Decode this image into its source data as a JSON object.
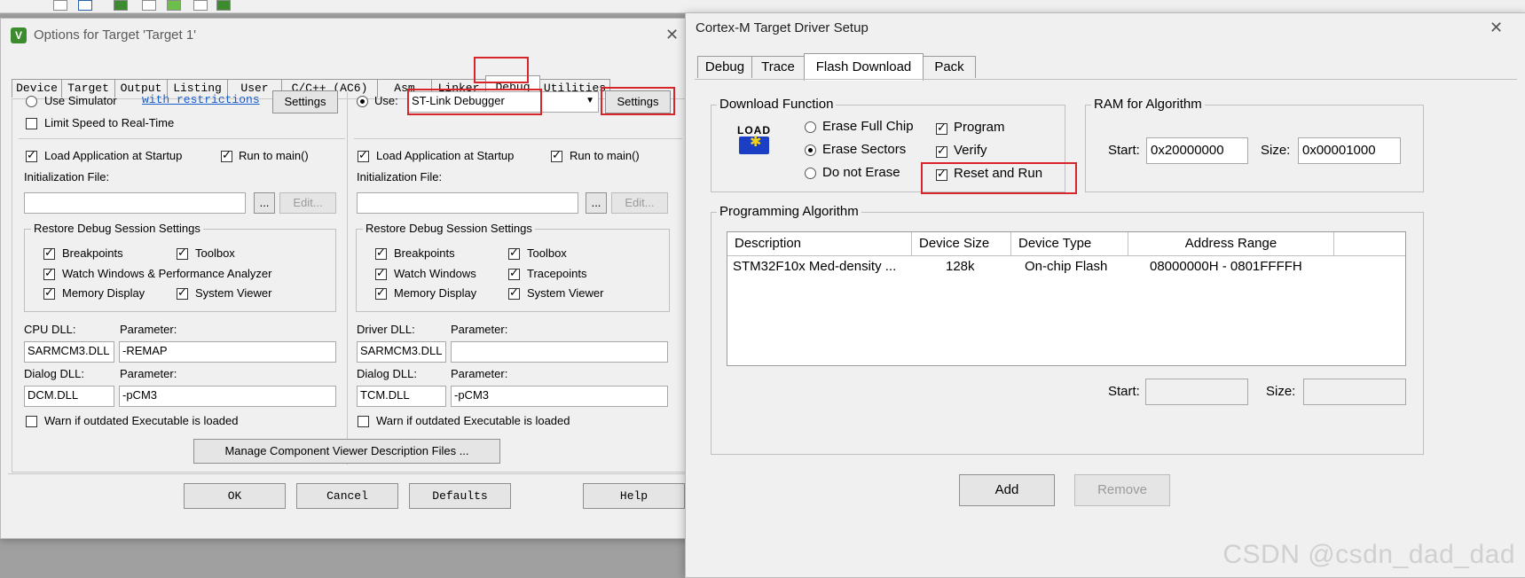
{
  "options_window": {
    "title": "Options for Target 'Target 1'",
    "tabs": [
      "Device",
      "Target",
      "Output",
      "Listing",
      "User",
      "C/C++ (AC6)",
      "Asm",
      "Linker",
      "Debug",
      "Utilities"
    ],
    "selected_tab": "Debug",
    "left": {
      "use_simulator": "Use Simulator",
      "with_restrictions": "with restrictions",
      "settings": "Settings",
      "limit_speed": "Limit Speed to Real-Time",
      "load_app": "Load Application at Startup",
      "run_to_main": "Run to main()",
      "init_file": "Initialization File:",
      "browse": "...",
      "edit": "Edit...",
      "restore_group": "Restore Debug Session Settings",
      "breakpoints": "Breakpoints",
      "toolbox": "Toolbox",
      "watch_windows": "Watch Windows & Performance Analyzer",
      "memory_display": "Memory Display",
      "system_viewer": "System Viewer",
      "cpu_dll_label": "CPU DLL:",
      "parameter_label": "Parameter:",
      "cpu_dll": "SARMCM3.DLL",
      "cpu_param": "-REMAP",
      "dialog_dll_label": "Dialog DLL:",
      "dialog_dll": "DCM.DLL",
      "dialog_param": "-pCM3",
      "warn": "Warn if outdated Executable is loaded"
    },
    "right": {
      "use": "Use:",
      "debugger": "ST-Link Debugger",
      "settings": "Settings",
      "load_app": "Load Application at Startup",
      "run_to_main": "Run to main()",
      "init_file": "Initialization File:",
      "browse": "...",
      "edit": "Edit...",
      "restore_group": "Restore Debug Session Settings",
      "breakpoints": "Breakpoints",
      "toolbox": "Toolbox",
      "watch_windows": "Watch Windows",
      "tracepoints": "Tracepoints",
      "memory_display": "Memory Display",
      "system_viewer": "System Viewer",
      "driver_dll_label": "Driver DLL:",
      "parameter_label": "Parameter:",
      "driver_dll": "SARMCM3.DLL",
      "driver_param": "",
      "dialog_dll_label": "Dialog DLL:",
      "dialog_dll": "TCM.DLL",
      "dialog_param": "-pCM3",
      "warn": "Warn if outdated Executable is loaded"
    },
    "manage_button": "Manage Component Viewer Description Files ...",
    "buttons": {
      "ok": "OK",
      "cancel": "Cancel",
      "defaults": "Defaults",
      "help": "Help"
    }
  },
  "driver_window": {
    "title": "Cortex-M Target Driver Setup",
    "tabs": [
      "Debug",
      "Trace",
      "Flash Download",
      "Pack"
    ],
    "selected_tab": "Flash Download",
    "download_function": {
      "group": "Download Function",
      "load_icon_text": "LOAD",
      "erase_full_chip": "Erase Full Chip",
      "erase_sectors": "Erase Sectors",
      "do_not_erase": "Do not Erase",
      "program": "Program",
      "verify": "Verify",
      "reset_and_run": "Reset and Run",
      "selected_erase": "Erase Sectors"
    },
    "ram": {
      "group": "RAM for Algorithm",
      "start_label": "Start:",
      "start": "0x20000000",
      "size_label": "Size:",
      "size": "0x00001000"
    },
    "programming_algorithm": {
      "group": "Programming Algorithm",
      "columns": [
        "Description",
        "Device Size",
        "Device Type",
        "Address Range"
      ],
      "rows": [
        {
          "description": "STM32F10x Med-density ...",
          "device_size": "128k",
          "device_type": "On-chip Flash",
          "address_range": "08000000H - 0801FFFFH"
        }
      ],
      "start_label": "Start:",
      "size_label": "Size:",
      "start": "",
      "size": ""
    },
    "add": "Add",
    "remove": "Remove"
  },
  "watermark": "CSDN @csdn_dad_dad",
  "colors": {
    "highlight_red": "#d7252c",
    "dialog_bg": "#f0f0f0",
    "link": "#1a5ecc"
  }
}
